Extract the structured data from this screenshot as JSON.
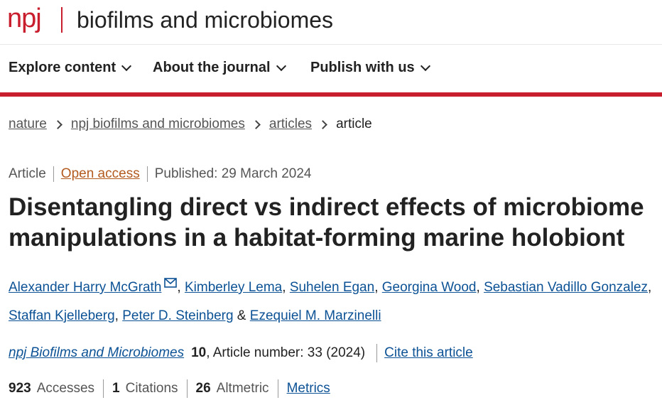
{
  "masthead": {
    "logo_npj": "npj",
    "journal_name": "biofilms and microbiomes"
  },
  "nav": {
    "items": [
      {
        "label": "Explore content"
      },
      {
        "label": "About the journal"
      },
      {
        "label": "Publish with us"
      }
    ]
  },
  "breadcrumb": {
    "items": [
      {
        "label": "nature"
      },
      {
        "label": "npj biofilms and microbiomes"
      },
      {
        "label": "articles"
      }
    ],
    "current": "article"
  },
  "article_meta": {
    "type": "Article",
    "access": "Open access",
    "published": "Published: 29 March 2024"
  },
  "title": "Disentangling direct vs indirect effects of microbiome manipulations in a habitat-forming marine holobiont",
  "authors": [
    "Alexander Harry McGrath",
    "Kimberley Lema",
    "Suhelen Egan",
    "Georgina Wood",
    "Sebastian Vadillo Gonzalez",
    "Staffan Kjelleberg",
    "Peter D. Steinberg",
    "Ezequiel M. Marzinelli"
  ],
  "author_separators": {
    "comma": ", ",
    "and": " & "
  },
  "citation": {
    "journal": "npj Biofilms and Microbiomes",
    "volume": "10",
    "article_number": ", Article number: 33 (2024)",
    "cite_label": "Cite this article"
  },
  "metrics": {
    "accesses_count": "923",
    "accesses_label": "Accesses",
    "citations_count": "1",
    "citations_label": "Citations",
    "altmetric_count": "26",
    "altmetric_label": "Altmetric",
    "metrics_link": "Metrics"
  },
  "colors": {
    "brand_red": "#c91e2e",
    "link_blue": "#0c5295",
    "open_access_orange": "#b35a1f"
  },
  "icons": {
    "author_contact": "mail-icon",
    "nav_dropdown": "chevron-down-icon",
    "breadcrumb_separator": "chevron-right-icon"
  }
}
